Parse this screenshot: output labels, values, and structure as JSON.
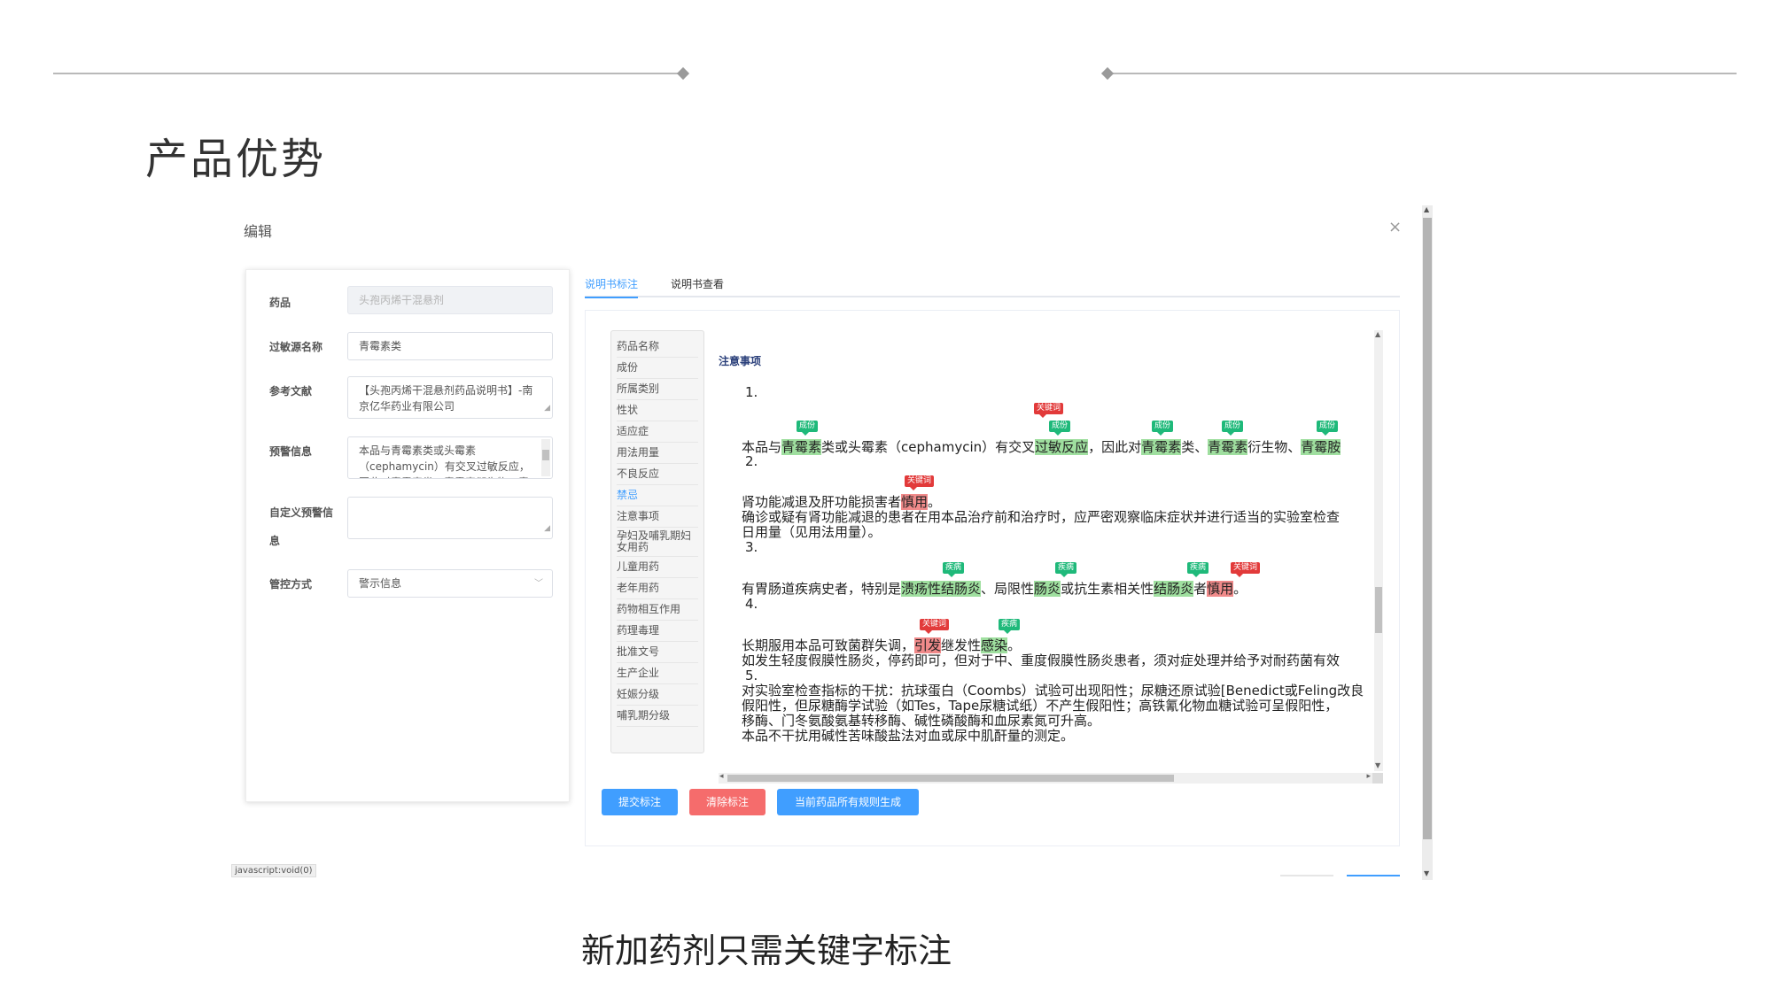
{
  "slide": {
    "title": "产品优势",
    "caption": "新加药剂只需关键字标注"
  },
  "dialog": {
    "title": "编辑",
    "close": "×",
    "status_link": "javascript:void(0)"
  },
  "form": {
    "drug": {
      "label": "药品",
      "value": "头孢丙烯干混悬剂"
    },
    "allergen": {
      "label": "过敏源名称",
      "value": "青霉素类"
    },
    "reference": {
      "label": "参考文献",
      "value": "【头孢丙烯干混悬剂药品说明书】-南京亿华药业有限公司"
    },
    "warning": {
      "label": "预警信息",
      "value": "本品与青霉素类或头霉素（cephamycin）有交叉过敏反应，因此对青霉素类、青霉素衍生物、青霉胺"
    },
    "custom_warning": {
      "label": "自定义预警信息",
      "value": ""
    },
    "control": {
      "label": "管控方式",
      "value": "警示信息"
    }
  },
  "tabs": [
    {
      "label": "说明书标注",
      "active": true
    },
    {
      "label": "说明书查看",
      "active": false
    }
  ],
  "nav": [
    {
      "label": "药品名称"
    },
    {
      "label": "成份"
    },
    {
      "label": "所属类别"
    },
    {
      "label": "性状"
    },
    {
      "label": "适应症"
    },
    {
      "label": "用法用量"
    },
    {
      "label": "不良反应"
    },
    {
      "label": "禁忌",
      "active": true
    },
    {
      "label": "注意事项"
    },
    {
      "label": "孕妇及哺乳期妇女用药"
    },
    {
      "label": "儿童用药"
    },
    {
      "label": "老年用药"
    },
    {
      "label": "药物相互作用"
    },
    {
      "label": "药理毒理"
    },
    {
      "label": "批准文号"
    },
    {
      "label": "生产企业"
    },
    {
      "label": "妊娠分级"
    },
    {
      "label": "哺乳期分级"
    }
  ],
  "text": {
    "section_title": "注意事项",
    "tags": {
      "ingredient": "成份",
      "disease": "疾病",
      "keyword": "关键词"
    },
    "l1_num": "1.",
    "l1_a": "本品与",
    "l1_b": "青霉素",
    "l1_c": "类或头霉素（cephamycin）有交叉",
    "l1_d": "过敏反应",
    "l1_e": "，因此对",
    "l1_f": "青霉素",
    "l1_g": "类、",
    "l1_h": "青霉素",
    "l1_i": "衍生物、",
    "l1_j": "青霉胺",
    "l2_num": "2.",
    "l2_a": "肾功能减退及肝功能损害者",
    "l2_b": "慎用",
    "l2_c": "。",
    "l2_d": "确诊或疑有肾功能减退的患者在用本品治疗前和治疗时，应严密观察临床症状并进行适当的实验室检查",
    "l2_e": "日用量（见用法用量）。",
    "l3_num": "3.",
    "l3_a": "有胃肠道疾病史者，特别是",
    "l3_b": "溃疡性结肠炎",
    "l3_c": "、局限性",
    "l3_d": "肠炎",
    "l3_e": "或抗生素相关性",
    "l3_f": "结肠炎",
    "l3_g": "者",
    "l3_h": "慎用",
    "l3_i": "。",
    "l4_num": "4.",
    "l4_a": "长期服用本品可致菌群失调，",
    "l4_b": "引发",
    "l4_c": "继发性",
    "l4_d": "感染",
    "l4_e": "。",
    "l4_f": "如发生轻度假膜性肠炎，停药即可，但对于中、重度假膜性肠炎患者，须对症处理并给予对耐药菌有效",
    "l5_num": "5.",
    "l5_a": "对实验室检查指标的干扰：抗球蛋白（Coombs）试验可出现阳性；尿糖还原试验[Benedict或Feling改良",
    "l5_b": "假阳性，但尿糖酶学试验（如Tes，Tape尿糖试纸）不产生假阳性；高铁氰化物血糖试验可呈假阳性，",
    "l5_c": "移酶、门冬氨酸氨基转移酶、碱性磷酸酶和血尿素氮可升高。",
    "l5_d": "本品不干扰用碱性苦味酸盐法对血或尿中肌酐量的测定。"
  },
  "buttons": {
    "submit": "提交标注",
    "clear": "清除标注",
    "generate": "当前药品所有规则生成"
  },
  "colors": {
    "primary": "#409eff",
    "danger": "#f56c6c",
    "ingredient_tag": "#1fb97a",
    "keyword_tag": "#e23a3a"
  }
}
